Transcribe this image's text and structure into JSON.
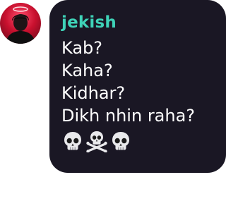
{
  "message": {
    "username": "jekish",
    "lines": [
      "Kab?",
      "Kaha?",
      "Kidhar?",
      "Dikh nhin raha?"
    ],
    "emojis": [
      "skull-icon",
      "skull-and-crossbones-icon",
      "skull-icon"
    ]
  },
  "colors": {
    "bubble_background": "#1a1724",
    "username": "#3fd3b8",
    "text": "#ffffff",
    "avatar_accent": "#c8102e"
  }
}
